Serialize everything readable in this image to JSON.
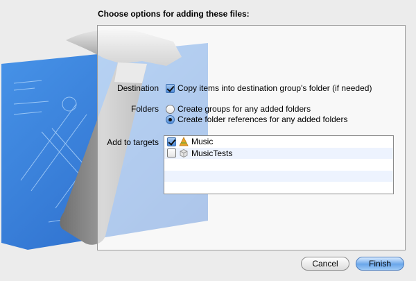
{
  "dialog": {
    "title": "Choose options for adding these files:"
  },
  "destination": {
    "label": "Destination",
    "copy_option": {
      "label": "Copy items into destination group's folder (if needed)",
      "checked": true
    }
  },
  "folders": {
    "label": "Folders",
    "options": [
      {
        "label": "Create groups for any added folders",
        "selected": false
      },
      {
        "label": "Create folder references for any added folders",
        "selected": true
      }
    ]
  },
  "targets": {
    "label": "Add to targets",
    "items": [
      {
        "name": "Music",
        "checked": true,
        "icon": "app-icon"
      },
      {
        "name": "MusicTests",
        "checked": false,
        "icon": "bundle-icon"
      }
    ]
  },
  "buttons": {
    "cancel": "Cancel",
    "finish": "Finish"
  },
  "colors": {
    "accent": "#4d8ad8",
    "blueprint": "#1f6fd8"
  }
}
